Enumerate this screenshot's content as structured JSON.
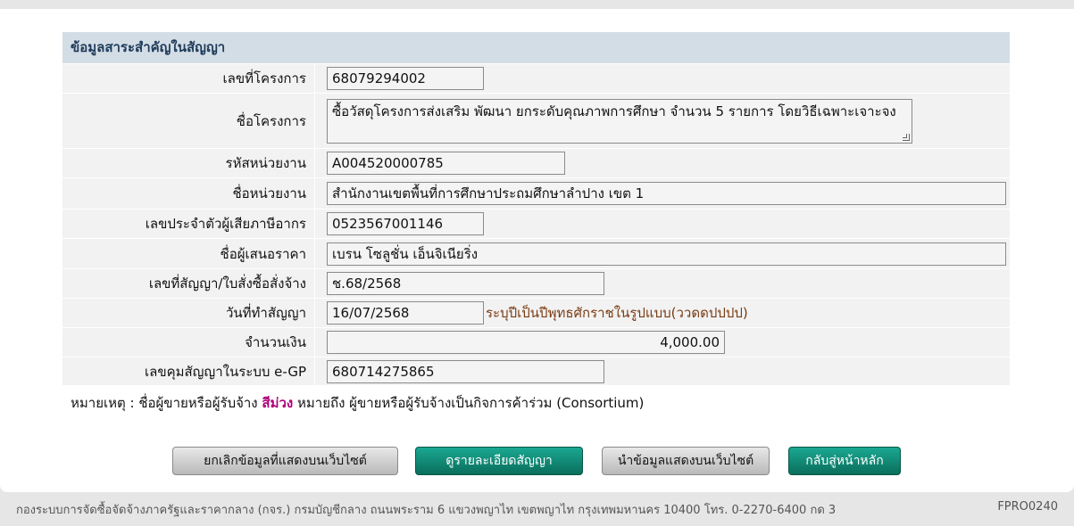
{
  "section": {
    "title": "ข้อมูลสาระสำคัญในสัญญา"
  },
  "fields": {
    "project_no": {
      "label": "เลขที่โครงการ",
      "value": "68079294002"
    },
    "project_name": {
      "label": "ชื่อโครงการ",
      "value": "ซื้อวัสดุโครงการส่งเสริม พัฒนา ยกระดับคุณภาพการศึกษา จำนวน 5 รายการ โดยวิธีเฉพาะเจาะจง"
    },
    "agency_code": {
      "label": "รหัสหน่วยงาน",
      "value": "A004520000785"
    },
    "agency_name": {
      "label": "ชื่อหน่วยงาน",
      "value": "สำนักงานเขตพื้นที่การศึกษาประถมศึกษาลำปาง เขต 1"
    },
    "tax_id": {
      "label": "เลขประจำตัวผู้เสียภาษีอากร",
      "value": "0523567001146"
    },
    "bidder_name": {
      "label": "ชื่อผู้เสนอราคา",
      "value": "เบรน โซลูชั่น เอ็นจิเนียริ่ง"
    },
    "contract_no": {
      "label": "เลขที่สัญญา/ใบสั่งซื้อสั่งจ้าง",
      "value": "ช.68/2568"
    },
    "contract_date": {
      "label": "วันที่ทำสัญญา",
      "value": "16/07/2568",
      "hint": "ระบุปีเป็นปีพุทธศักราชในรูปแบบ(ววดดปปปป)"
    },
    "amount": {
      "label": "จำนวนเงิน",
      "value": "4,000.00"
    },
    "egp_no": {
      "label": "เลขคุมสัญญาในระบบ e-GP",
      "value": "680714275865"
    }
  },
  "note": {
    "prefix": "หมายเหตุ : ชื่อผู้ขายหรือผู้รับจ้าง",
    "highlight": "สีม่วง",
    "suffix": "หมายถึง ผู้ขายหรือผู้รับจ้างเป็นกิจการค้าร่วม (Consortium)"
  },
  "buttons": {
    "cancel_display": "ยกเลิกข้อมูลที่แสดงบนเว็บไซต์",
    "view_contract": "ดูรายละเอียดสัญญา",
    "publish_display": "นำข้อมูลแสดงบนเว็บไซต์",
    "back_home": "กลับสู่หน้าหลัก"
  },
  "footer": {
    "address": "กองระบบการจัดซื้อจัดจ้างภาครัฐและราคากลาง (กจร.) กรมบัญชีกลาง ถนนพระราม 6 แขวงพญาไท เขตพญาไท กรุงเทพมหานคร 10400 โทร. 0-2270-6400 กด 3",
    "page_code": "FPRO0240"
  },
  "colors": {
    "header_bg": "#d3dde6",
    "row_bg": "#f2f2f2",
    "teal_button": "#0f8a75",
    "consortium_purple": "#b0007a"
  }
}
